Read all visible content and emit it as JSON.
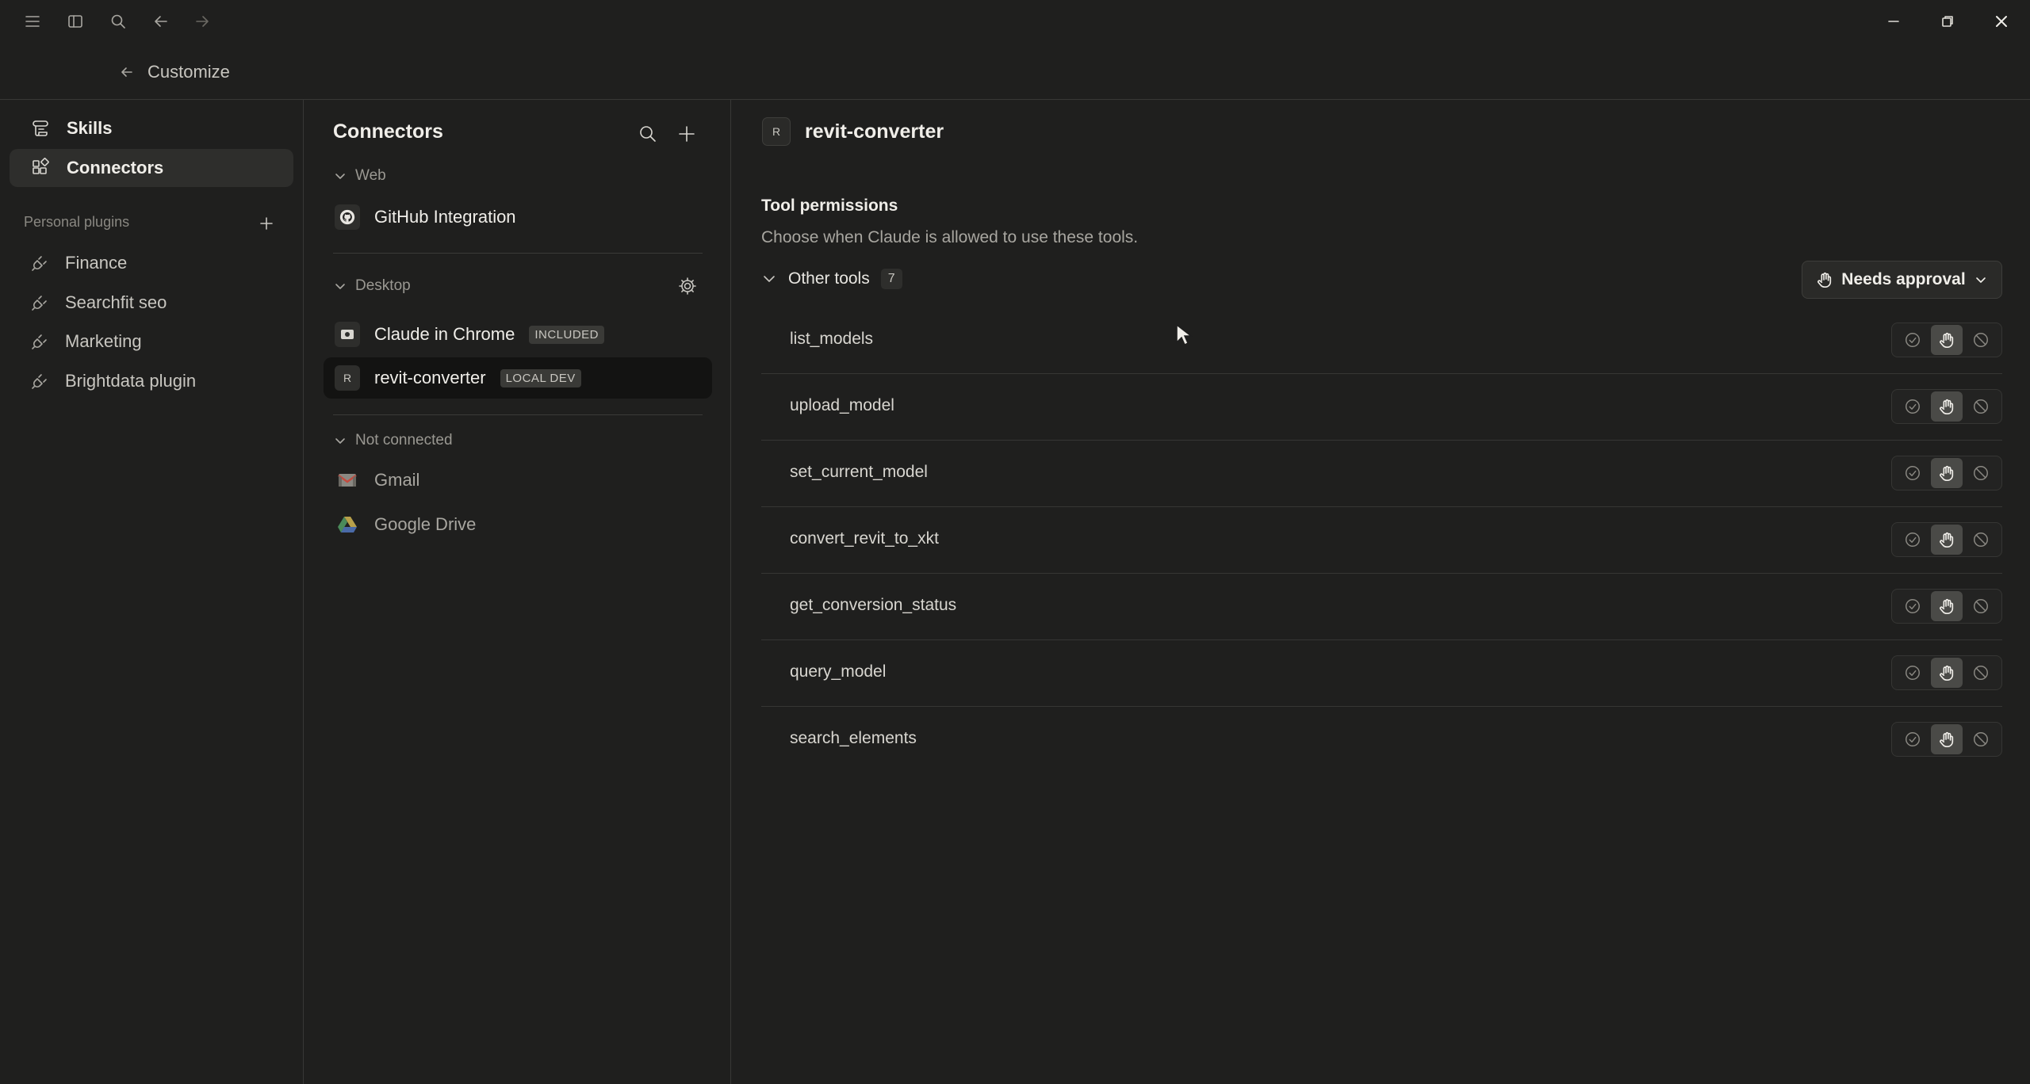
{
  "header": {
    "back_label": "Customize"
  },
  "leftnav": {
    "items": [
      {
        "label": "Skills",
        "icon": "scroll-icon"
      },
      {
        "label": "Connectors",
        "icon": "connectors-icon",
        "active": true
      }
    ],
    "plugins_label": "Personal plugins",
    "plugins": [
      {
        "label": "Finance",
        "icon": "plug-icon"
      },
      {
        "label": "Searchfit seo",
        "icon": "plug-icon"
      },
      {
        "label": "Marketing",
        "icon": "plug-icon"
      },
      {
        "label": "Brightdata plugin",
        "icon": "plug-icon"
      }
    ]
  },
  "connectors": {
    "title": "Connectors",
    "groups": {
      "web": {
        "label": "Web",
        "items": [
          {
            "name": "GitHub Integration",
            "icon": "github-icon"
          }
        ]
      },
      "desktop": {
        "label": "Desktop",
        "items": [
          {
            "name": "Claude in Chrome",
            "badge": "INCLUDED",
            "icon": "chrome-ext-icon"
          },
          {
            "name": "revit-converter",
            "badge": "LOCAL DEV",
            "icon_letter": "R",
            "active": true
          }
        ]
      },
      "not_connected": {
        "label": "Not connected",
        "items": [
          {
            "name": "Gmail",
            "icon": "gmail-icon"
          },
          {
            "name": "Google Drive",
            "icon": "google-drive-icon"
          }
        ]
      }
    }
  },
  "detail": {
    "avatar_letter": "R",
    "title": "revit-converter",
    "permissions_title": "Tool permissions",
    "permissions_desc": "Choose when Claude is allowed to use these tools.",
    "tools_group_label": "Other tools",
    "tools_count": "7",
    "approval_label": "Needs approval",
    "tools": [
      {
        "name": "list_models",
        "mode": "needs-approval"
      },
      {
        "name": "upload_model",
        "mode": "needs-approval"
      },
      {
        "name": "set_current_model",
        "mode": "needs-approval"
      },
      {
        "name": "convert_revit_to_xkt",
        "mode": "needs-approval"
      },
      {
        "name": "get_conversion_status",
        "mode": "needs-approval"
      },
      {
        "name": "query_model",
        "mode": "needs-approval"
      },
      {
        "name": "search_elements",
        "mode": "needs-approval"
      }
    ]
  },
  "colors": {
    "background": "#1f1f1e",
    "panel_border": "#383836",
    "selected": "#4a4a47",
    "text": "#f0eee9"
  }
}
